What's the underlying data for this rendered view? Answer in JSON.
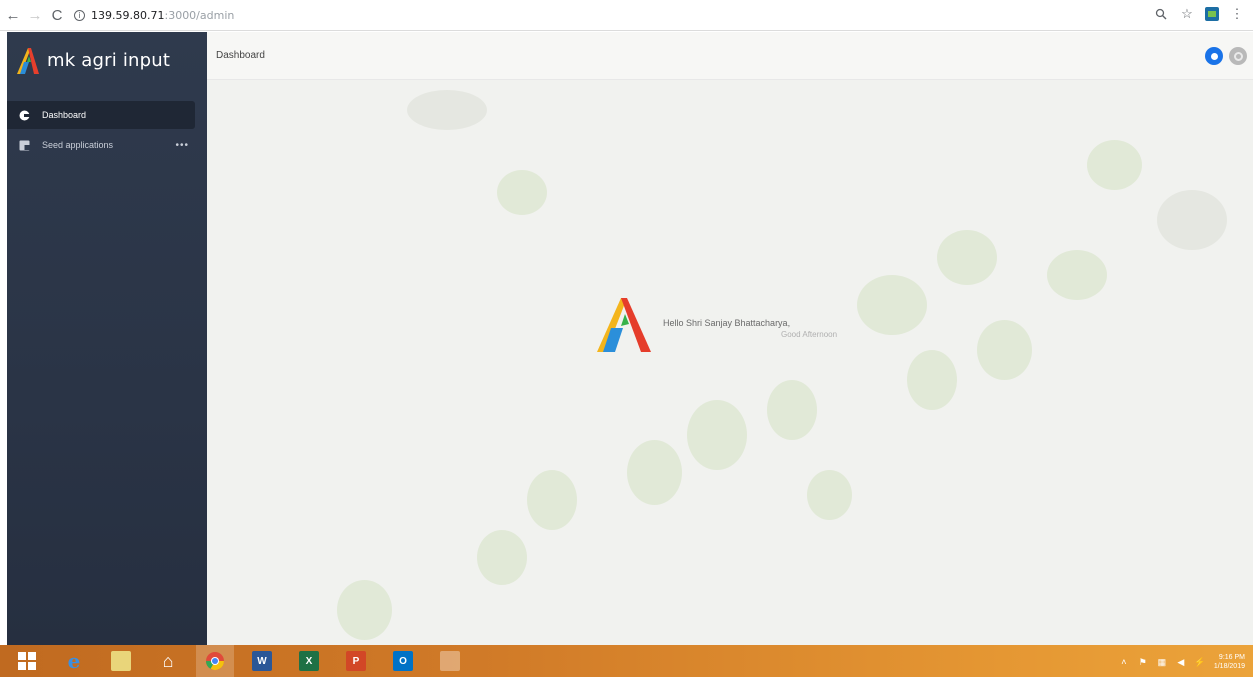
{
  "browser": {
    "url_host": "139.59.80.71",
    "url_path": ":3000/admin"
  },
  "app": {
    "brand_name": "mk agri input"
  },
  "sidebar": {
    "items": [
      {
        "label": "Dashboard",
        "icon": "gauge-icon",
        "active": true
      },
      {
        "label": "Seed applications",
        "icon": "document-icon",
        "active": false,
        "more": "•••"
      }
    ]
  },
  "header": {
    "title": "Dashboard"
  },
  "welcome": {
    "hello": "Hello Shri Sanjay Bhattacharya,",
    "greeting": "Good Afternoon"
  },
  "taskbar": {
    "time": "9:16 PM",
    "date": "1/18/2019"
  },
  "colors": {
    "sidebar": "#2f3a4d",
    "accent_blue": "#1a73e8",
    "taskbar": "#d17b28"
  }
}
